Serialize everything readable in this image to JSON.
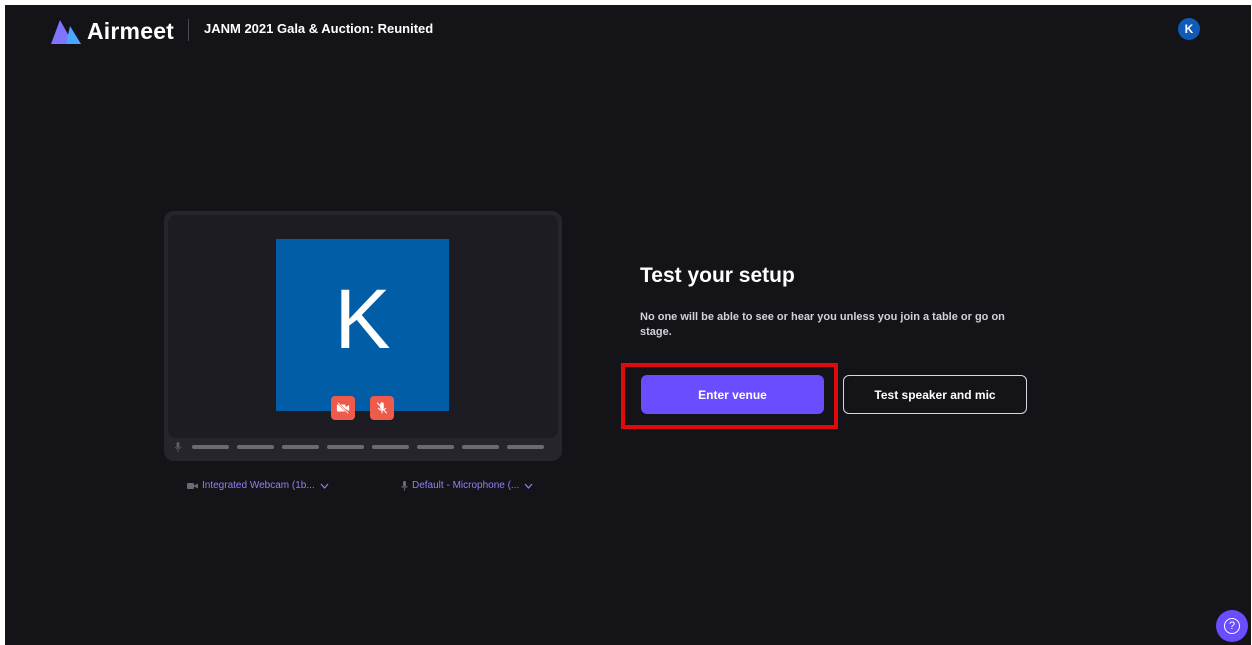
{
  "header": {
    "brand": "Airmeet",
    "event_title": "JANM 2021 Gala & Auction: Reunited",
    "avatar_initial": "K"
  },
  "preview": {
    "tile_initial": "K",
    "camera_status_icon": "video-off-icon",
    "mic_status_icon": "mic-off-icon",
    "camera_device": "Integrated Webcam (1b...",
    "mic_device": "Default - Microphone (..."
  },
  "setup": {
    "title": "Test your setup",
    "description": "No one will be able to see or hear you unless you join a table or go on stage.",
    "enter_label": "Enter venue",
    "test_label": "Test speaker and mic"
  },
  "help": {
    "icon_text": "?"
  },
  "colors": {
    "background": "#141318",
    "accent": "#6a4dff",
    "tile": "#005da6",
    "muted_button": "#ef5b4a",
    "highlight": "#e10a0a"
  }
}
